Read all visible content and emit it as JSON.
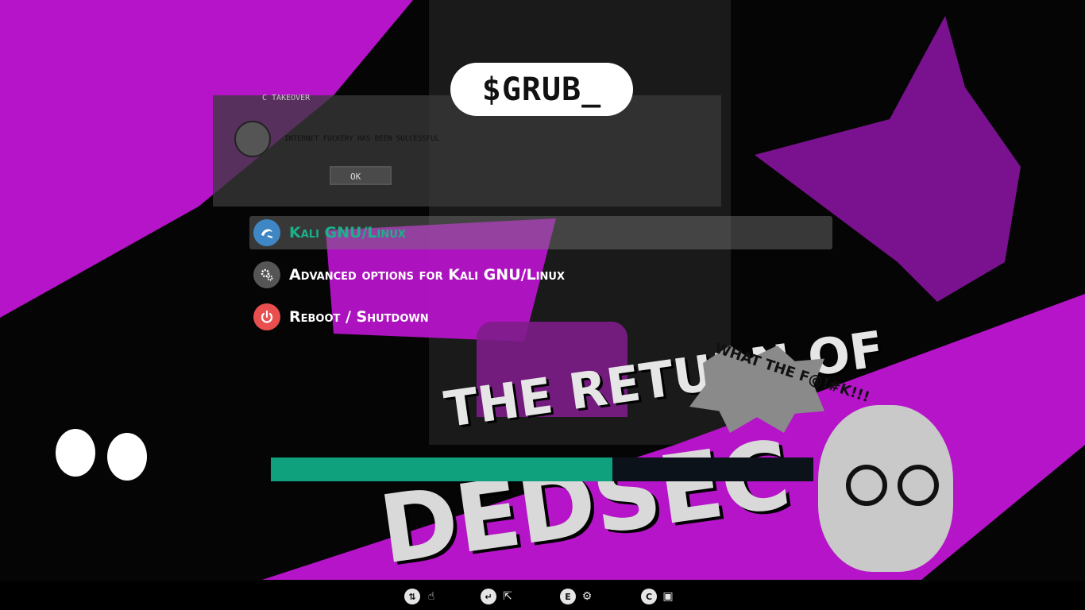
{
  "title": "$GRUB_",
  "background": {
    "dialog_title": "C TAKEOVER",
    "dialog_message": "INTERNET FUCKERY HAS BEEN SUCCESSFUL",
    "dialog_ok": "OK",
    "headline_small": "THE RETURN OF",
    "headline_big": "DEDSEC",
    "speech_bubble": "WHAT THE F@!#K!!!"
  },
  "menu": {
    "entries": [
      {
        "label": "Kali GNU/Linux",
        "icon": "kali-dragon-icon",
        "icon_color": "#3f86c4",
        "selected": true
      },
      {
        "label": "Advanced options for Kali GNU/Linux",
        "icon": "gears-icon",
        "icon_color": "#555555",
        "selected": false
      },
      {
        "label": "Reboot / Shutdown",
        "icon": "power-icon",
        "icon_color": "#e94f4f",
        "selected": false
      }
    ]
  },
  "progress": {
    "value": 0.63,
    "fill_color": "#0fa07e",
    "track_color": "#0c121a"
  },
  "hints": [
    {
      "key": "⇅",
      "action_icon": "hand-pointer-icon",
      "action_glyph": "☝"
    },
    {
      "key": "↵",
      "action_icon": "boot-icon",
      "action_glyph": "⇱"
    },
    {
      "key": "E",
      "action_icon": "edit-gear-icon",
      "action_glyph": "⚙"
    },
    {
      "key": "C",
      "action_icon": "console-icon",
      "action_glyph": "▣"
    }
  ]
}
